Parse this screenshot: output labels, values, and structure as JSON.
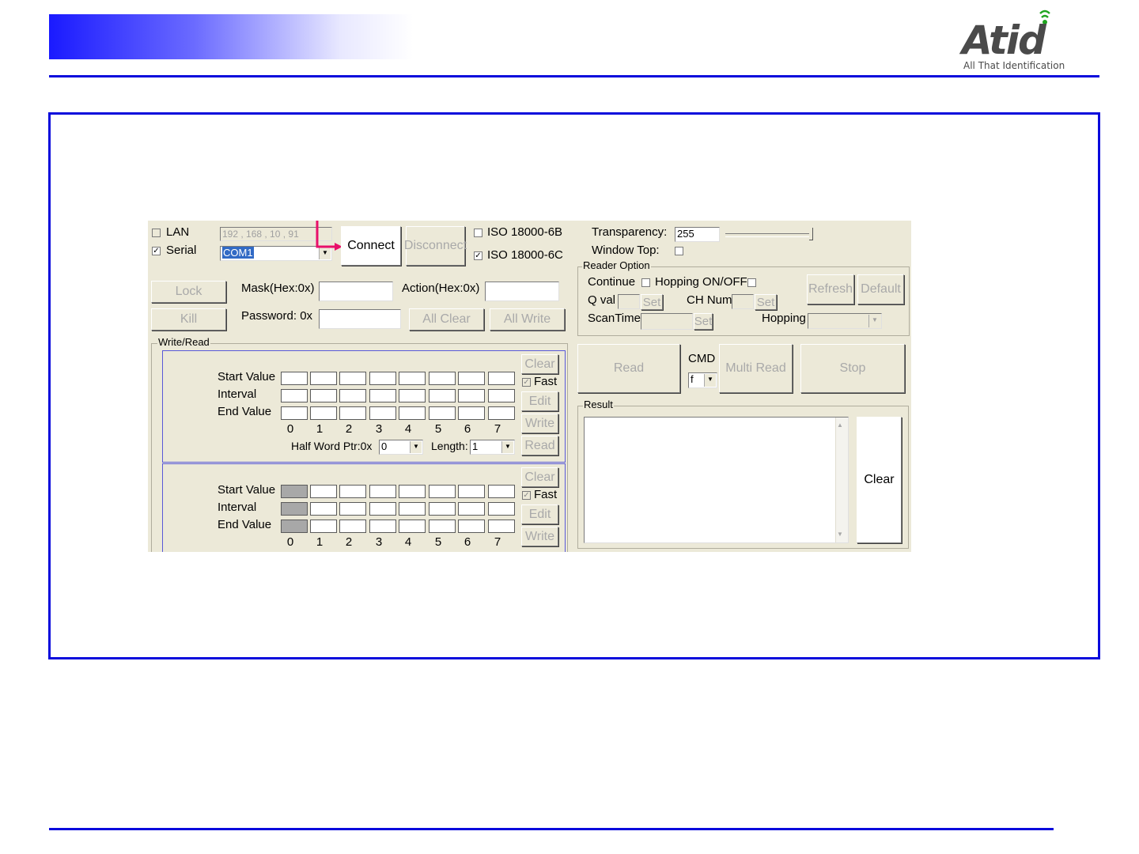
{
  "logo": {
    "brand": "Atid",
    "tagline": "All That Identification"
  },
  "app": {
    "connection": {
      "lan_label": "LAN",
      "lan_checked": false,
      "serial_label": "Serial",
      "serial_checked": true,
      "ip_value": "192 , 168 ,  10  ,  91",
      "com_value": "COM1",
      "connect_label": "Connect",
      "disconnect_label": "Disconnect"
    },
    "protocols": {
      "iso6b_label": "ISO 18000-6B",
      "iso6b_checked": false,
      "iso6c_label": "ISO 18000-6C",
      "iso6c_checked": true
    },
    "tag_ops": {
      "lock_label": "Lock",
      "kill_label": "Kill",
      "mask_label": "Mask(Hex:0x)",
      "action_label": "Action(Hex:0x)",
      "password_label": "Password: 0x",
      "all_clear_label": "All Clear",
      "all_write_label": "All Write"
    },
    "write_read": {
      "group_label": "Write/Read",
      "panels": [
        {
          "start_label": "Start Value",
          "interval_label": "Interval",
          "end_label": "End Value",
          "indices": [
            "0",
            "1",
            "2",
            "3",
            "4",
            "5",
            "6",
            "7"
          ],
          "clear_label": "Clear",
          "fast_label": "Fast",
          "fast_checked": true,
          "edit_label": "Edit",
          "write_label": "Write",
          "read_label": "Read",
          "ptr_label": "Half Word Ptr:0x",
          "ptr_value": "0",
          "length_label": "Length:",
          "length_value": "1"
        },
        {
          "start_label": "Start Value",
          "interval_label": "Interval",
          "end_label": "End Value",
          "indices": [
            "0",
            "1",
            "2",
            "3",
            "4",
            "5",
            "6",
            "7"
          ],
          "clear_label": "Clear",
          "fast_label": "Fast",
          "fast_checked": true,
          "edit_label": "Edit",
          "write_label": "Write"
        }
      ]
    },
    "transparency": {
      "label": "Transparency:",
      "value": "255",
      "slider_fraction": 1.0
    },
    "window_top": {
      "label": "Window Top:",
      "checked": false
    },
    "reader_option": {
      "group_label": "Reader Option",
      "continue_label": "Continue",
      "continue_checked": false,
      "hopping_onoff_label": "Hopping ON/OFF",
      "hopping_onoff_checked": false,
      "refresh_label": "Refresh",
      "default_label": "Default",
      "qval_label": "Q val",
      "set_label": "Set",
      "chnum_label": "CH Num",
      "scantime_label": "ScanTime",
      "hopping_label": "Hopping"
    },
    "actions": {
      "read_label": "Read",
      "cmd_label": "CMD",
      "cmd_value": "f",
      "multi_read_label": "Multi Read",
      "stop_label": "Stop"
    },
    "result": {
      "group_label": "Result",
      "clear_label": "Clear"
    }
  }
}
